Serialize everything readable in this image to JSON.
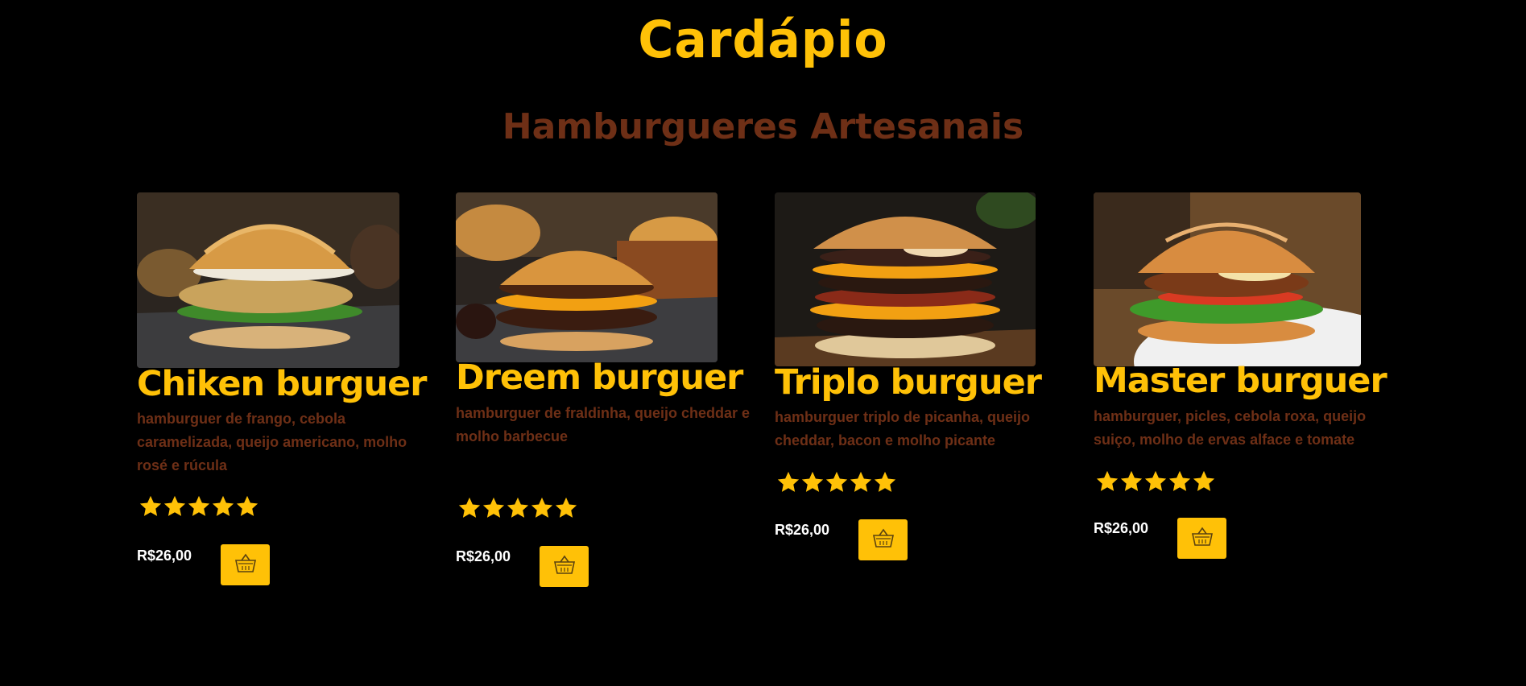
{
  "menu": {
    "title": "Cardápio",
    "subtitle": "Hamburgueres Artesanais"
  },
  "colors": {
    "accent": "#ffc107",
    "secondary": "#6e2f16",
    "background": "#000000",
    "price": "#ffffff"
  },
  "products": [
    {
      "name": "Chiken burguer",
      "description": "hamburguer de frango, cebola caramelizada, queijo americano, molho rosé e rúcula",
      "rating": 5,
      "price": "R$26,00",
      "image": "chicken-burger-photo",
      "cart_icon": "basket-icon"
    },
    {
      "name": "Dreem burguer",
      "description": "hamburguer de fraldinha, queijo cheddar e molho barbecue",
      "rating": 5,
      "price": "R$26,00",
      "image": "cheddar-burger-photo",
      "cart_icon": "basket-icon"
    },
    {
      "name": "Triplo burguer",
      "description": "hamburguer triplo de picanha, queijo cheddar, bacon e molho picante",
      "rating": 5,
      "price": "R$26,00",
      "image": "triple-burger-photo",
      "cart_icon": "basket-icon"
    },
    {
      "name": "Master burguer",
      "description": "hamburguer, picles, cebola roxa, queijo suiço, molho de ervas alface e tomate",
      "rating": 5,
      "price": "R$26,00",
      "image": "master-burger-photo",
      "cart_icon": "basket-icon"
    }
  ]
}
